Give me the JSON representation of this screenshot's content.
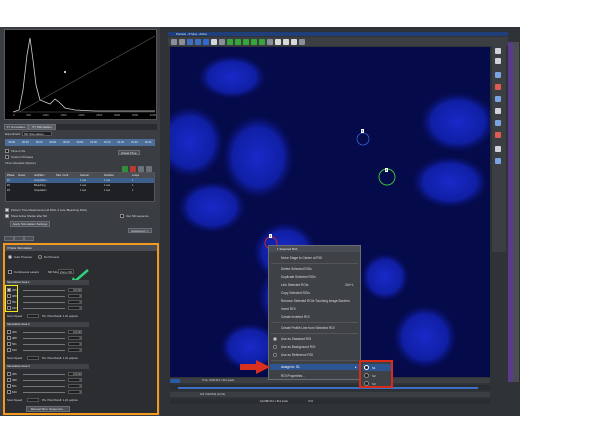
{
  "left_panel": {
    "histogram": {
      "axis_labels": [
        "0",
        "500",
        "1000",
        "1500",
        "2000",
        "2500",
        "3000",
        "3500",
        "4000"
      ]
    },
    "tabs": [
      "XY Annotation",
      "XY Stimulation"
    ],
    "experiment_label": "Experiment",
    "experiment_value": "ND Stimulation",
    "time_label": "Time in file",
    "custom_label": "Custom Phrases",
    "timeline_ticks": [
      "00:00",
      "00:10",
      "00:20",
      "00:30",
      "00:40",
      "00:50",
      "01:00",
      "01:10",
      "01:20",
      "01:30",
      "01:40"
    ],
    "reset_button": "Reset Time",
    "time_schedule_label": "Time schedule (Stylus:)",
    "schedule_columns": [
      "Phase",
      "Group",
      "Acq/Stim",
      "Stim. Conf.",
      "Interval",
      "Duration",
      "Loops"
    ],
    "schedule_rows": [
      [
        "#1",
        "",
        "Acquisition",
        "",
        "1 sec",
        "1 sec",
        "1"
      ],
      [
        "#2",
        "",
        "Bleaching",
        "",
        "1 sec",
        "1 sec",
        "1"
      ],
      [
        "#3",
        "",
        "Acquisition",
        "",
        "1 sec",
        "1 sec",
        "1"
      ]
    ],
    "perform_label": "Perform Time Measurement (8 ROIs, 0 sets, Bleaching ROIs)",
    "show_active_label": "Show Active Shutter after ND",
    "use_nd_label": "Use ND sequence",
    "apply_button": "Apply Stimulation Settings",
    "advanced_button": "Advanced >>"
  },
  "stim_panel": {
    "title": "XYplus Stimulation",
    "auto_process": "Auto Process",
    "no_process": "No Process",
    "continuous_label": "Continuous Lasers",
    "nd_mode_label": "ND Mode",
    "nd_mode_value": "Zone ND",
    "sections": [
      {
        "title": "Stimulation Area 1",
        "lines": [
          "405",
          "488",
          "561",
          "640"
        ],
        "values": [
          "100.00",
          "0",
          "0",
          "0"
        ],
        "scan_speed": "Scan Speed",
        "pixel_dwell": "Pix. Pixel Dwell: 1.22 μs/pixel"
      },
      {
        "title": "Stimulation Area 2",
        "lines": [
          "405",
          "488",
          "561",
          "640"
        ],
        "values": [
          "100.00",
          "0",
          "0",
          "0"
        ],
        "scan_speed": "Scan Speed",
        "pixel_dwell": "Pix. Pixel Dwell: 1.22 μs/pixel"
      },
      {
        "title": "Stimulation Area 3",
        "lines": [
          "405",
          "488",
          "561",
          "640"
        ],
        "values": [
          "100.00",
          "0",
          "0",
          "0"
        ],
        "scan_speed": "Scan Speed",
        "pixel_dwell": "Pix. Pixel Dwell: 1.22 μs/pixel"
      }
    ],
    "manual_button": "Manual Stim. Sequence..."
  },
  "image_window": {
    "title": "Preview - XYplus - Active",
    "roi_labels": [
      "1",
      "2",
      "3"
    ],
    "status_time": "Time: 1000 512 x 512 pixels",
    "status_bar": "0x0 | 512x512 (12 bit)",
    "status_bottom": "Sel:0Bit 512 x 512 pixels",
    "status_bottom2": "8 bit"
  },
  "context_menu": {
    "header": "1 Selected ROI",
    "items": [
      "Move Stage to Center of ROI",
      "Delete Selected ROIs",
      "Duplicate Selected ROIs",
      "Link Selected ROIs",
      "Copy Selected ROIs",
      "Remove Selected ROIs Touching Image Borders",
      "Invert ROI",
      "Create Inverted ROI",
      "Create Profile Line from Selected ROI",
      "Use as Standard ROI",
      "Use as Background ROI",
      "Use as Reference ROI",
      "Assign to: S1",
      "ROI Properties..."
    ],
    "link_shortcut": "Ctrl+L",
    "submenu": [
      "S1",
      "S2",
      "S3"
    ]
  },
  "colors": {
    "highlight_orange": "#f39a1e",
    "highlight_yellow": "#f2ea1d",
    "highlight_red": "#d72b1c",
    "arrow_red": "#d9311e",
    "arrow_green": "#2fd27a",
    "roi_green": "#3bd13b",
    "image_bg": "#050a4a"
  }
}
